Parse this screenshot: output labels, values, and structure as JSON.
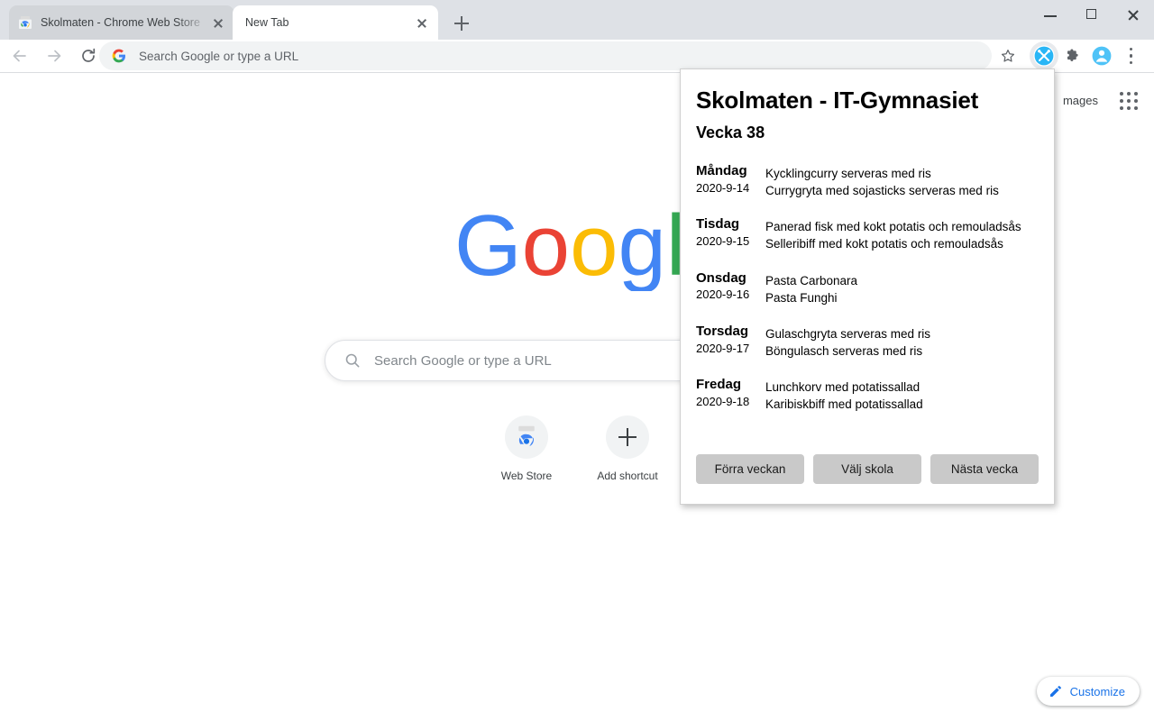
{
  "window": {
    "controls": [
      {
        "name": "minimize",
        "glyph": "minimize-icon"
      },
      {
        "name": "maximize",
        "glyph": "maximize-icon"
      },
      {
        "name": "close",
        "glyph": "close-icon"
      }
    ]
  },
  "tabs": [
    {
      "title": "Skolmaten - Chrome Web Store",
      "favicon": "chrome-web-store-icon",
      "active": false
    },
    {
      "title": "New Tab",
      "favicon": "none",
      "active": true
    }
  ],
  "toolbar": {
    "back_icon": "back-arrow-icon",
    "forward_icon": "forward-arrow-icon",
    "reload_icon": "reload-icon",
    "omnibox": {
      "placeholder": "Search Google or type a URL",
      "value": "",
      "leading_icon": "google-g-icon"
    },
    "bookmark_icon": "star-icon",
    "extension_skolmaten_icon": "skolmaten-cutlery-icon",
    "extensions_icon": "puzzle-piece-icon",
    "profile_icon": "profile-avatar-icon",
    "menu_icon": "three-dot-menu-icon"
  },
  "newtab": {
    "images_link": "mages",
    "apps_grid_icon": "apps-grid-icon",
    "logo": "google-logo",
    "search": {
      "placeholder": "Search Google or type a URL",
      "icon": "search-icon"
    },
    "shortcuts": [
      {
        "label": "Web Store",
        "icon": "chrome-web-store-icon"
      },
      {
        "label": "Add shortcut",
        "icon": "plus-icon"
      }
    ],
    "customize": {
      "label": "Customize",
      "icon": "pencil-icon",
      "color": "#1a73e8"
    }
  },
  "popup": {
    "title": "Skolmaten - IT-Gymnasiet",
    "week": "Vecka 38",
    "days": [
      {
        "name": "Måndag",
        "date": "2020-9-14",
        "meals": [
          "Kycklingcurry serveras med ris",
          "Currygryta med sojasticks serveras med ris"
        ]
      },
      {
        "name": "Tisdag",
        "date": "2020-9-15",
        "meals": [
          "Panerad fisk med kokt potatis och remouladsås",
          "Selleribiff med kokt potatis och remouladsås"
        ]
      },
      {
        "name": "Onsdag",
        "date": "2020-9-16",
        "meals": [
          "Pasta Carbonara",
          "Pasta Funghi"
        ]
      },
      {
        "name": "Torsdag",
        "date": "2020-9-17",
        "meals": [
          "Gulaschgryta serveras med ris",
          "Böngulasch serveras med ris"
        ]
      },
      {
        "name": "Fredag",
        "date": "2020-9-18",
        "meals": [
          "Lunchkorv med potatissallad",
          "Karibiskbiff med potatissallad"
        ]
      }
    ],
    "buttons": {
      "prev_week": "Förra veckan",
      "pick_school": "Välj skola",
      "next_week": "Nästa vecka"
    }
  },
  "colors": {
    "tabstrip_bg": "#dee1e6",
    "omnibox_bg": "#f1f3f4",
    "accent_blue": "#1a73e8",
    "popup_button_bg": "#c9c9c9"
  }
}
